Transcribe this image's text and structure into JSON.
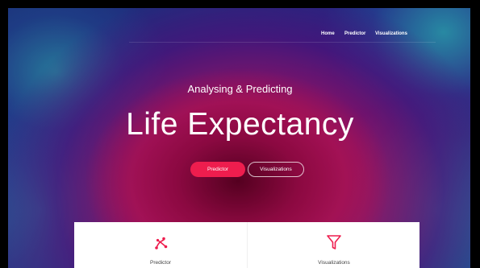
{
  "nav": {
    "items": [
      {
        "label": "Home"
      },
      {
        "label": "Predictor"
      },
      {
        "label": "Visualizations"
      }
    ]
  },
  "hero": {
    "subtitle": "Analysing & Predicting",
    "title": "Life Expectancy"
  },
  "buttons": {
    "primary_label": "Predictor",
    "secondary_label": "Visualizations"
  },
  "features": [
    {
      "label": "Predictor",
      "icon": "branch-icon"
    },
    {
      "label": "Visualizations",
      "icon": "funnel-icon"
    }
  ],
  "colors": {
    "accent": "#ee1d4e",
    "text_light": "#ffffff",
    "card_bg": "#ffffff",
    "card_text": "#444444"
  }
}
